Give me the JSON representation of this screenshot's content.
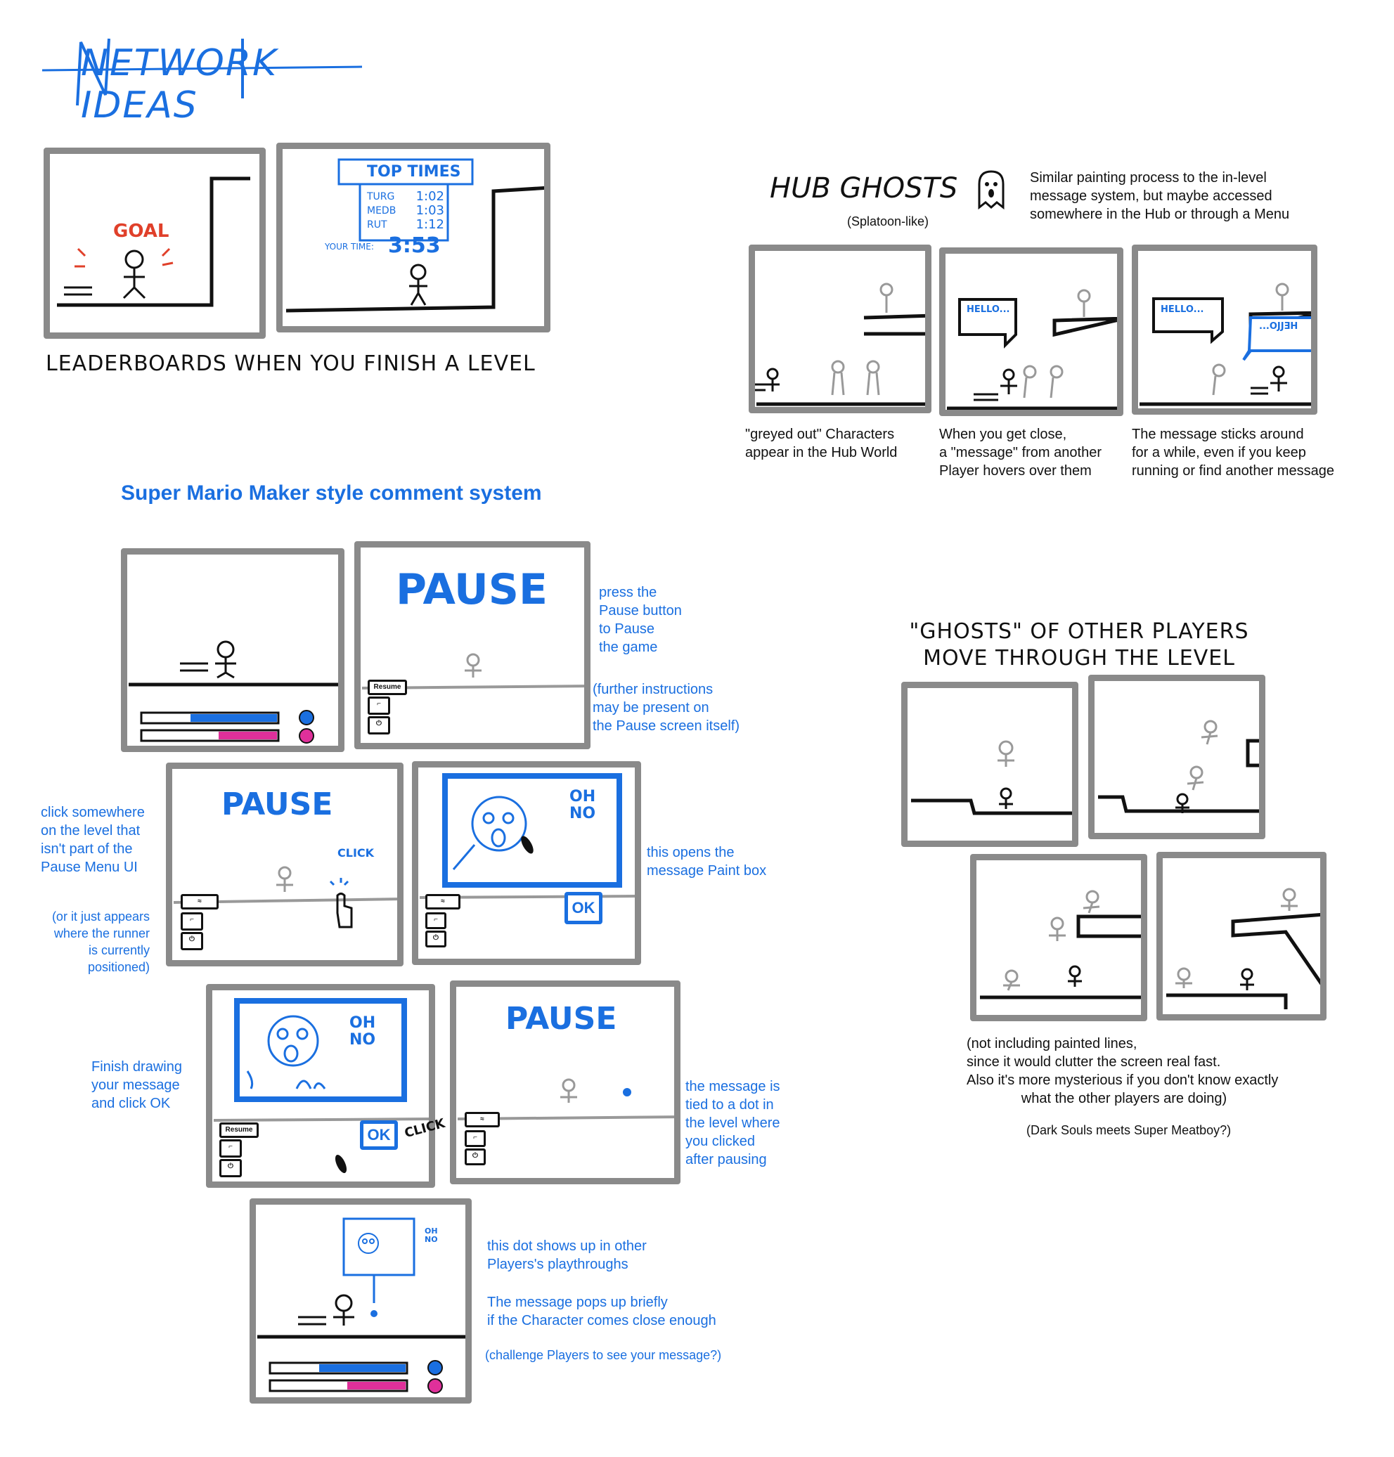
{
  "title": "NETWORK IDEAS",
  "leaderboard": {
    "goal_text": "GOAL",
    "board_title": "TOP TIMES",
    "entries": [
      {
        "name": "TURG",
        "time": "1:02"
      },
      {
        "name": "MEDB",
        "time": "1:03"
      },
      {
        "name": "RUT",
        "time": "1:12"
      }
    ],
    "your_time_label": "YOUR TIME:",
    "your_time": "3:53",
    "caption": "LEADERBOARDS WHEN YOU FINISH A LEVEL"
  },
  "hub_ghosts": {
    "heading": "HUB GHOSTS",
    "subheading": "(Splatoon-like)",
    "description": "Similar painting process to the in-level\nmessage system, but maybe accessed\nsomewhere in the Hub or through a Menu",
    "bubble_text": "HELLO...",
    "bubble_text_mirrored": "...OJJƎH",
    "captions": [
      "\"greyed out\" Characters\nappear in the Hub World",
      "When you get close,\na \"message\" from another\nPlayer hovers over them",
      "The message sticks around\nfor a while, even if you keep\nrunning or find another message"
    ]
  },
  "comment_system": {
    "heading": "Super Mario Maker style comment system",
    "pause_text": "PAUSE",
    "resume_label": "Resume",
    "click_text": "CLICK",
    "oh_no_text": "OH\nNO",
    "ok_label": "OK",
    "notes": {
      "press_pause": "press the\nPause button\n to Pause\n  the game",
      "further": "(further instructions\n may be present on\n the Pause screen itself)",
      "click_somewhere": "click somewhere\non the level that\nisn't part of the\nPause Menu UI",
      "or_appears": "(or it just appears\nwhere the runner\nis currently\npositioned)",
      "opens_paint": "this opens the\nmessage Paint box",
      "finish_drawing": "Finish drawing\nyour message\nand click OK",
      "tied_to_dot": "the message is\ntied to a dot in\nthe level where\nyou clicked\nafter pausing",
      "dot_shows": "this dot shows up in other\nPlayers's playthroughs",
      "pops_up": "The message pops up briefly\nif the Character comes close enough",
      "challenge": "(challenge Players to see your message?)"
    }
  },
  "ghost_players": {
    "heading": "\"GHOSTS\" OF OTHER PLAYERS\nMOVE THROUGH THE LEVEL",
    "note": "(not including painted lines,\nsince it would clutter the screen real fast.\nAlso it's more mysterious if you don't know exactly\n              what the other players are doing)",
    "footnote": "(Dark Souls meets Super Meatboy?)"
  },
  "colors": {
    "ink": "#111111",
    "blue": "#1a6fe0",
    "red": "#e0402a",
    "grey": "#8a8a8a",
    "magenta": "#e0309a"
  }
}
